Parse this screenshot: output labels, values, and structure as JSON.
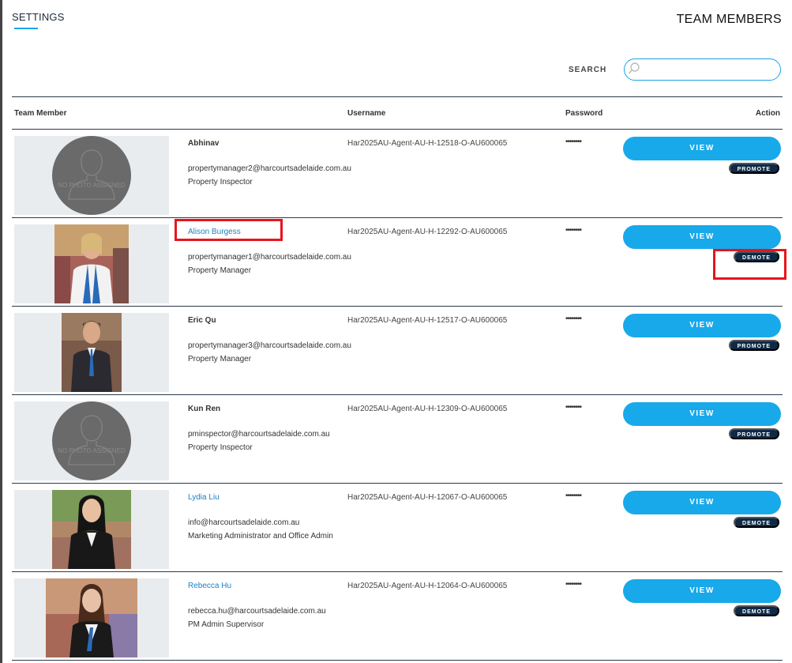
{
  "settings_label": "SETTINGS",
  "page_title": "TEAM MEMBERS",
  "search": {
    "label": "SEARCH",
    "value": "",
    "placeholder": ""
  },
  "columns": {
    "member": "Team Member",
    "username": "Username",
    "password": "Password",
    "action": "Action"
  },
  "photo_placeholder": "NO PHOTO ASSIGNED",
  "view_label": "VIEW",
  "members": [
    {
      "name": "Abhinav",
      "email": "propertymanager2@harcourtsadelaide.com.au",
      "role": "Property Inspector",
      "username": "Har2025AU-Agent-AU-H-12518-O-AU600065",
      "password": "••••••••",
      "action": "PROMOTE"
    },
    {
      "name": "Alison Burgess",
      "email": "propertymanager1@harcourtsadelaide.com.au",
      "role": "Property Manager",
      "username": "Har2025AU-Agent-AU-H-12292-O-AU600065",
      "password": "••••••••",
      "action": "DEMOTE"
    },
    {
      "name": "Eric Qu",
      "email": "propertymanager3@harcourtsadelaide.com.au",
      "role": "Property Manager",
      "username": "Har2025AU-Agent-AU-H-12517-O-AU600065",
      "password": "••••••••",
      "action": "PROMOTE"
    },
    {
      "name": "Kun Ren",
      "email": "pminspector@harcourtsadelaide.com.au",
      "role": "Property Inspector",
      "username": "Har2025AU-Agent-AU-H-12309-O-AU600065",
      "password": "••••••••",
      "action": "PROMOTE"
    },
    {
      "name": "Lydia Liu",
      "email": "info@harcourtsadelaide.com.au",
      "role": "Marketing Administrator and Office Admin",
      "username": "Har2025AU-Agent-AU-H-12067-O-AU600065",
      "password": "••••••••",
      "action": "DEMOTE"
    },
    {
      "name": "Rebecca Hu",
      "email": "rebecca.hu@harcourtsadelaide.com.au",
      "role": "PM Admin Supervisor",
      "username": "Har2025AU-Agent-AU-H-12064-O-AU600065",
      "password": "••••••••",
      "action": "DEMOTE"
    }
  ],
  "colors": {
    "accent": "#18a9ea",
    "badge": "#0e2a47",
    "link": "#1a82c4",
    "highlight": "#e8141c"
  }
}
